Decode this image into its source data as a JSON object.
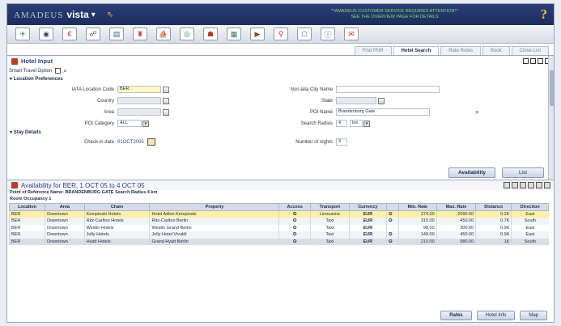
{
  "app": {
    "brand_prefix": "AMADEUS",
    "brand_name": "vista",
    "banner_line1": "**AMADEUS CUSTOMER SERVICE REQUIRES ATTENTION**",
    "banner_line2": "SEE THE OVERVIEW PAGE FOR DETAILS",
    "help": "?"
  },
  "toolbar": {
    "icons": [
      "airline-icon",
      "car-icon",
      "rail-icon",
      "travelers-icon",
      "queue-icon",
      "hotel-icon",
      "cruise-icon",
      "globe-icon",
      "passenger-icon",
      "map-icon",
      "insurance-icon",
      "train-icon",
      "tour-icon",
      "info-icon",
      "mail-icon"
    ]
  },
  "module_tabs": [
    "Find PNR",
    "Hotel Search",
    "Rate Rules",
    "Book",
    "Close List"
  ],
  "hotel_input": {
    "title": "Hotel Input",
    "smart_travel_label": "Smart Travel Option",
    "location_prefs_label": "Location Preferences",
    "iata_label": "IATA Location Code",
    "iata_value": "BER",
    "country_label": "Country",
    "area_label": "Area",
    "poi_category_label": "POI Category",
    "poi_category_value": "ALL",
    "nonlata_label": "Non-lata City Name",
    "state_label": "State",
    "poi_name_label": "POI Name",
    "poi_name_value": "Brandenburg Gate",
    "search_radius_label": "Search Radius",
    "search_radius_value": "4",
    "search_radius_unit": "km",
    "stay_details_label": "Stay Details",
    "checkin_label": "Check-in date",
    "checkin_value": "01OCT2005",
    "nights_label": "Number of nights",
    "nights_value": "3",
    "availability_btn": "Availability",
    "list_btn": "List"
  },
  "availability": {
    "title": "Availability for BER, 1 OCT 05 to 4 OCT 05",
    "poi_line": "Point of Reference Name: BRANDENBURG GATE Search Radius 4 km",
    "occupancy_label": "Room Occupancy 1",
    "headers": [
      "Location",
      "Area",
      "Chain",
      "Property",
      "Access",
      "Transport",
      "Currency",
      "",
      "Min. Rate",
      "Max. Rate",
      "Distance",
      "Direction"
    ],
    "rows": [
      [
        "BER",
        "Downtown",
        "Kempinski Hotels",
        "Hotel Adlon Kempinski",
        "✪",
        "Limousine",
        "EUR",
        "✪",
        "274.00",
        "2095.00",
        "0.2K",
        "East"
      ],
      [
        "BER",
        "Downtown",
        "Ritz-Carlton Hotels",
        "Ritz-Carlton Berlin",
        "✪",
        "Taxi",
        "EUR",
        "✪",
        "315.00",
        "450.00",
        "0.7K",
        "South"
      ],
      [
        "BER",
        "Downtown",
        "Westin Hotels",
        "Westin Grand Berlin",
        "✪",
        "Taxi",
        "EUR",
        "",
        "98.00",
        "300.00",
        "0.9K",
        "East"
      ],
      [
        "BER",
        "Downtown",
        "Jolly Hotels",
        "Jolly Hotel Vivaldi",
        "✪",
        "Taxi",
        "EUR",
        "✪",
        "149.00",
        "450.00",
        "0.9K",
        "East"
      ],
      [
        "BER",
        "Downtown",
        "Hyatt Hotels",
        "Grand Hyatt Berlin",
        "✪",
        "Taxi",
        "EUR",
        "✪",
        "210.00",
        "980.00",
        "1K",
        "South"
      ]
    ],
    "rates_btn": "Rates",
    "hotel_info_btn": "Hotel Info",
    "map_btn": "Map"
  }
}
